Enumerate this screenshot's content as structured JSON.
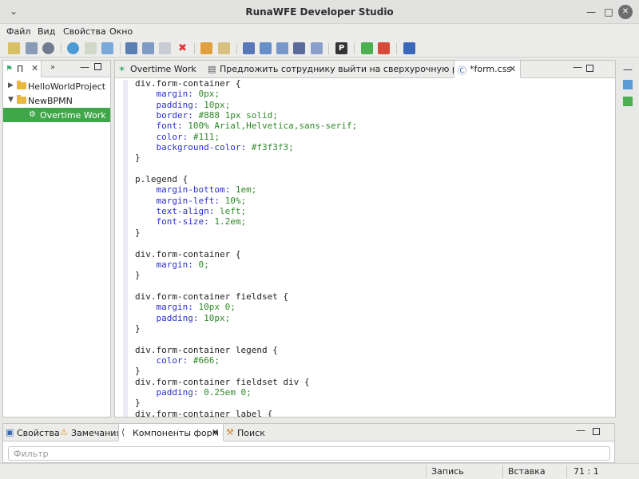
{
  "window": {
    "title": "RunaWFE Developer Studio"
  },
  "menu": [
    "Файл",
    "Вид",
    "Свойства",
    "Окно"
  ],
  "navigator": {
    "tab_label": "П",
    "tree": [
      {
        "label": "HelloWorldProject",
        "expanded": false
      },
      {
        "label": "NewBPMN",
        "expanded": true
      },
      {
        "label": "Overtime Work",
        "selected": true
      }
    ]
  },
  "editor": {
    "tabs": [
      {
        "label": "Overtime Work"
      },
      {
        "label": "Предложить сотруднику выйти на сверхурочную работу"
      },
      {
        "label": "*form.css",
        "active": true
      }
    ],
    "code_lines": [
      [
        [
          "sel-t",
          "div.form-container {"
        ]
      ],
      [
        [
          "sp",
          "    "
        ],
        [
          "prop",
          "margin: "
        ],
        [
          "val",
          "0px;"
        ]
      ],
      [
        [
          "sp",
          "    "
        ],
        [
          "prop",
          "padding: "
        ],
        [
          "val",
          "10px;"
        ]
      ],
      [
        [
          "sp",
          "    "
        ],
        [
          "prop",
          "border: "
        ],
        [
          "val",
          "#888 1px solid;"
        ]
      ],
      [
        [
          "sp",
          "    "
        ],
        [
          "prop",
          "font: "
        ],
        [
          "val",
          "100% Arial,Helvetica,sans-serif;"
        ]
      ],
      [
        [
          "sp",
          "    "
        ],
        [
          "prop",
          "color: "
        ],
        [
          "val",
          "#111;"
        ]
      ],
      [
        [
          "sp",
          "    "
        ],
        [
          "prop",
          "background-color: "
        ],
        [
          "val",
          "#f3f3f3;"
        ]
      ],
      [
        [
          "brace",
          "}"
        ]
      ],
      [
        [
          "sp",
          ""
        ]
      ],
      [
        [
          "sel-t",
          "p.legend {"
        ]
      ],
      [
        [
          "sp",
          "    "
        ],
        [
          "prop",
          "margin-bottom: "
        ],
        [
          "val",
          "1em;"
        ]
      ],
      [
        [
          "sp",
          "    "
        ],
        [
          "prop",
          "margin-left: "
        ],
        [
          "val",
          "10%;"
        ]
      ],
      [
        [
          "sp",
          "    "
        ],
        [
          "prop",
          "text-align: "
        ],
        [
          "val",
          "left;"
        ]
      ],
      [
        [
          "sp",
          "    "
        ],
        [
          "prop",
          "font-size: "
        ],
        [
          "val",
          "1.2em;"
        ]
      ],
      [
        [
          "brace",
          "}"
        ]
      ],
      [
        [
          "sp",
          ""
        ]
      ],
      [
        [
          "sel-t",
          "div.form-container {"
        ]
      ],
      [
        [
          "sp",
          "    "
        ],
        [
          "prop",
          "margin: "
        ],
        [
          "val",
          "0;"
        ]
      ],
      [
        [
          "brace",
          "}"
        ]
      ],
      [
        [
          "sp",
          ""
        ]
      ],
      [
        [
          "sel-t",
          "div.form-container fieldset {"
        ]
      ],
      [
        [
          "sp",
          "    "
        ],
        [
          "prop",
          "margin: "
        ],
        [
          "val",
          "10px 0;"
        ]
      ],
      [
        [
          "sp",
          "    "
        ],
        [
          "prop",
          "padding: "
        ],
        [
          "val",
          "10px;"
        ]
      ],
      [
        [
          "brace",
          "}"
        ]
      ],
      [
        [
          "sp",
          ""
        ]
      ],
      [
        [
          "sel-t",
          "div.form-container legend {"
        ]
      ],
      [
        [
          "sp",
          "    "
        ],
        [
          "prop",
          "color: "
        ],
        [
          "val",
          "#666;"
        ]
      ],
      [
        [
          "brace",
          "}"
        ]
      ],
      [
        [
          "sel-t",
          "div.form-container fieldset div {"
        ]
      ],
      [
        [
          "sp",
          "    "
        ],
        [
          "prop",
          "padding: "
        ],
        [
          "val",
          "0.25em 0;"
        ]
      ],
      [
        [
          "brace",
          "}"
        ]
      ],
      [
        [
          "sel-t",
          "div.form-container label {"
        ]
      ]
    ]
  },
  "bottom": {
    "tabs": [
      {
        "label": "Свойства"
      },
      {
        "label": "Замечания"
      },
      {
        "label": "Компоненты форм",
        "active": true
      },
      {
        "label": "Поиск"
      }
    ],
    "filter_placeholder": "Фильтр"
  },
  "status": {
    "mode": "Запись",
    "insert": "Вставка",
    "position": "71 : 1"
  }
}
